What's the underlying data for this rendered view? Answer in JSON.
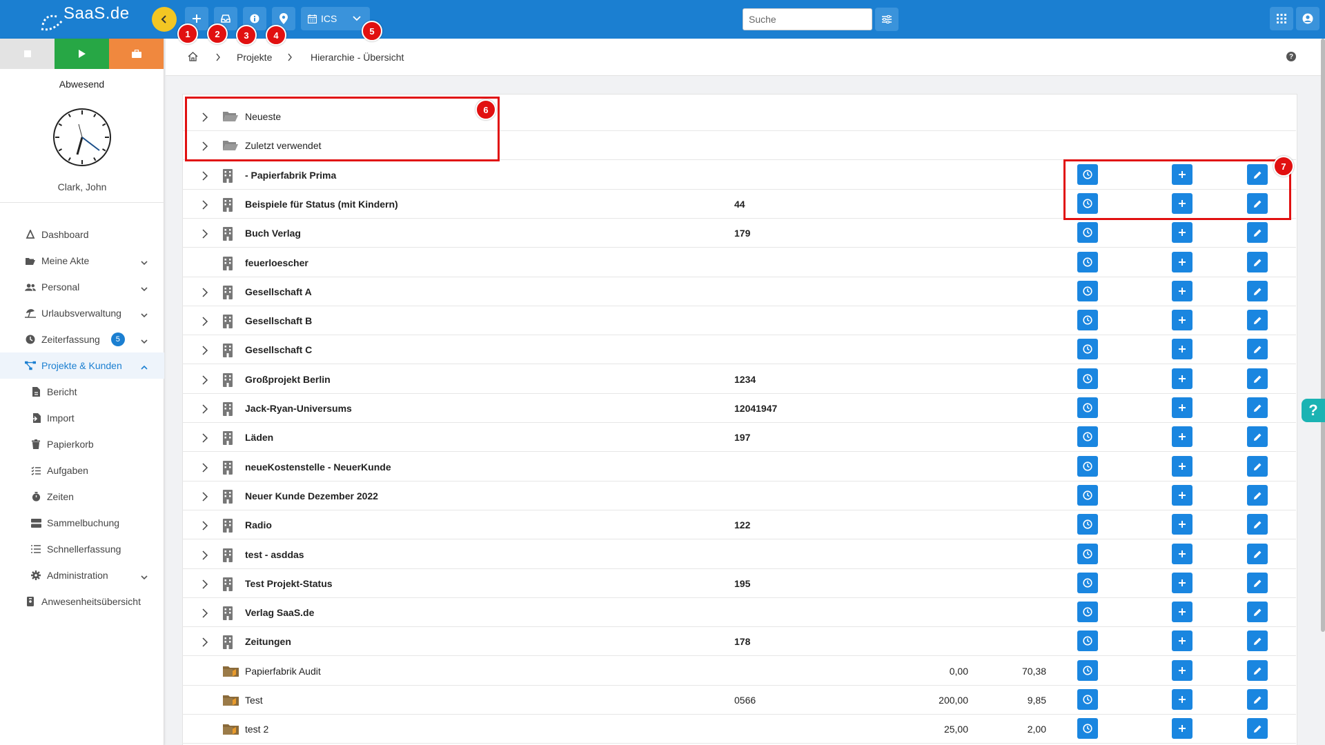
{
  "app": {
    "logo_text": "SaaS.de"
  },
  "toolbar": {
    "ics_label": "ICS"
  },
  "search": {
    "placeholder": "Suche"
  },
  "sidebar": {
    "status": "Abwesend",
    "user": "Clark, John",
    "items": [
      {
        "label": "Dashboard",
        "icon": "hierarchy-icon"
      },
      {
        "label": "Meine Akte",
        "icon": "folder-open-icon",
        "expandable": true
      },
      {
        "label": "Personal",
        "icon": "users-icon",
        "expandable": true
      },
      {
        "label": "Urlaubsverwaltung",
        "icon": "umbrella-beach-icon",
        "expandable": true
      },
      {
        "label": "Zeiterfassung",
        "icon": "clock-icon",
        "badge": "5",
        "expandable": true
      },
      {
        "label": "Projekte & Kunden",
        "icon": "project-diagram-icon",
        "expandable": true,
        "active": true
      },
      {
        "label": "Bericht",
        "icon": "file-icon",
        "sub": true
      },
      {
        "label": "Import",
        "icon": "file-import-icon",
        "sub": true
      },
      {
        "label": "Papierkorb",
        "icon": "trash-icon",
        "sub": true
      },
      {
        "label": "Aufgaben",
        "icon": "tasks-icon",
        "sub": true
      },
      {
        "label": "Zeiten",
        "icon": "stopwatch-icon",
        "sub": true
      },
      {
        "label": "Sammelbuchung",
        "icon": "server-icon",
        "sub": true
      },
      {
        "label": "Schnellerfassung",
        "icon": "list-icon",
        "sub": true
      },
      {
        "label": "Administration",
        "icon": "cog-icon",
        "sub": true,
        "expandable": true
      },
      {
        "label": "Anwesenheitsübersicht",
        "icon": "id-badge-icon"
      }
    ]
  },
  "breadcrumb": {
    "level1": "Projekte",
    "level2": "Hierarchie - Übersicht"
  },
  "rows": [
    {
      "name": "Neueste",
      "type": "folder",
      "bold": false,
      "expand": true,
      "num": "",
      "v1": "",
      "v2": "",
      "actions": false
    },
    {
      "name": "Zuletzt verwendet",
      "type": "folder",
      "bold": false,
      "expand": true,
      "num": "",
      "v1": "",
      "v2": "",
      "actions": false
    },
    {
      "name": "- Papierfabrik Prima",
      "type": "building",
      "bold": true,
      "expand": true,
      "num": "",
      "v1": "",
      "v2": "",
      "actions": true
    },
    {
      "name": "Beispiele für Status (mit Kindern)",
      "type": "building",
      "bold": true,
      "expand": true,
      "num": "44",
      "v1": "",
      "v2": "",
      "actions": true
    },
    {
      "name": "Buch Verlag",
      "type": "building",
      "bold": true,
      "expand": true,
      "num": "179",
      "v1": "",
      "v2": "",
      "actions": true
    },
    {
      "name": "feuerloescher",
      "type": "building",
      "bold": true,
      "expand": false,
      "num": "",
      "v1": "",
      "v2": "",
      "actions": true
    },
    {
      "name": "Gesellschaft A",
      "type": "building",
      "bold": true,
      "expand": true,
      "num": "",
      "v1": "",
      "v2": "",
      "actions": true
    },
    {
      "name": "Gesellschaft B",
      "type": "building",
      "bold": true,
      "expand": true,
      "num": "",
      "v1": "",
      "v2": "",
      "actions": true
    },
    {
      "name": "Gesellschaft C",
      "type": "building",
      "bold": true,
      "expand": true,
      "num": "",
      "v1": "",
      "v2": "",
      "actions": true
    },
    {
      "name": "Großprojekt Berlin",
      "type": "building",
      "bold": true,
      "expand": true,
      "num": "1234",
      "v1": "",
      "v2": "",
      "actions": true
    },
    {
      "name": "Jack-Ryan-Universums",
      "type": "building",
      "bold": true,
      "expand": true,
      "num": "12041947",
      "v1": "",
      "v2": "",
      "actions": true
    },
    {
      "name": "Läden",
      "type": "building",
      "bold": true,
      "expand": true,
      "num": "197",
      "v1": "",
      "v2": "",
      "actions": true
    },
    {
      "name": "neueKostenstelle - NeuerKunde",
      "type": "building",
      "bold": true,
      "expand": true,
      "num": "",
      "v1": "",
      "v2": "",
      "actions": true
    },
    {
      "name": "Neuer Kunde Dezember 2022",
      "type": "building",
      "bold": true,
      "expand": true,
      "num": "",
      "v1": "",
      "v2": "",
      "actions": true
    },
    {
      "name": "Radio",
      "type": "building",
      "bold": true,
      "expand": true,
      "num": "122",
      "v1": "",
      "v2": "",
      "actions": true
    },
    {
      "name": "test - asddas",
      "type": "building",
      "bold": true,
      "expand": true,
      "num": "",
      "v1": "",
      "v2": "",
      "actions": true
    },
    {
      "name": "Test Projekt-Status",
      "type": "building",
      "bold": true,
      "expand": true,
      "num": "195",
      "v1": "",
      "v2": "",
      "actions": true
    },
    {
      "name": "Verlag SaaS.de",
      "type": "building",
      "bold": true,
      "expand": true,
      "num": "",
      "v1": "",
      "v2": "",
      "actions": true
    },
    {
      "name": "Zeitungen",
      "type": "building",
      "bold": true,
      "expand": true,
      "num": "178",
      "v1": "",
      "v2": "",
      "actions": true
    },
    {
      "name": "Papierfabrik Audit",
      "type": "project",
      "bold": false,
      "expand": false,
      "num": "",
      "v1": "0,00",
      "v2": "70,38",
      "actions": true
    },
    {
      "name": "Test",
      "type": "project",
      "bold": false,
      "expand": false,
      "num": "0566",
      "v1": "200,00",
      "v2": "9,85",
      "actions": true
    },
    {
      "name": "test 2",
      "type": "project",
      "bold": false,
      "expand": false,
      "num": "",
      "v1": "25,00",
      "v2": "2,00",
      "actions": true
    }
  ],
  "annotations": [
    "1",
    "2",
    "3",
    "4",
    "5",
    "6",
    "7"
  ],
  "help": {
    "breadcrumb_help": "?",
    "float_help": "?"
  },
  "colors": {
    "primary": "#1b7fd1",
    "button": "#1a86e0",
    "annotation": "#e11010"
  }
}
